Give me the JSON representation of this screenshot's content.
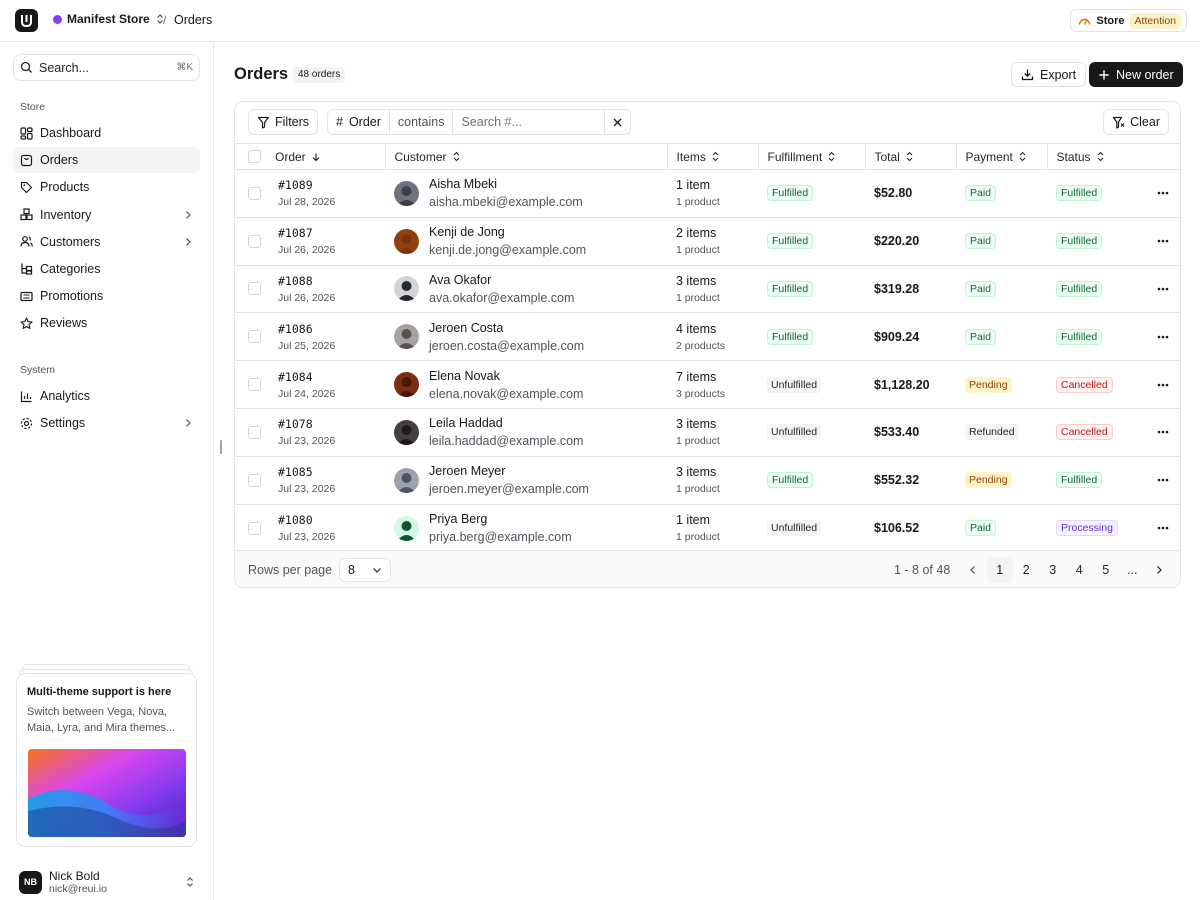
{
  "header": {
    "store_name": "Manifest Store",
    "breadcrumb_sep": "/",
    "breadcrumb_current": "Orders",
    "store_status_label": "Store",
    "store_status_badge": "Attention",
    "store_color": "#8b3cf0"
  },
  "sidebar": {
    "search_placeholder": "Search...",
    "search_shortcut": "⌘K",
    "section_store": "Store",
    "section_system": "System",
    "store_items": [
      {
        "label": "Dashboard",
        "icon": "dashboard-icon"
      },
      {
        "label": "Orders",
        "icon": "shopping-bag-icon",
        "active": true
      },
      {
        "label": "Products",
        "icon": "tag-icon"
      },
      {
        "label": "Inventory",
        "icon": "boxes-icon",
        "has_submenu": true
      },
      {
        "label": "Customers",
        "icon": "users-icon",
        "has_submenu": true
      },
      {
        "label": "Categories",
        "icon": "category-tree-icon"
      },
      {
        "label": "Promotions",
        "icon": "ticket-icon"
      },
      {
        "label": "Reviews",
        "icon": "star-icon"
      }
    ],
    "system_items": [
      {
        "label": "Analytics",
        "icon": "bar-chart-icon"
      },
      {
        "label": "Settings",
        "icon": "gear-icon",
        "has_submenu": true
      }
    ],
    "promo": {
      "title": "Multi-theme support is here",
      "text": "Switch between Vega, Nova, Maia, Lyra, and Mira themes..."
    },
    "user": {
      "initials": "NB",
      "name": "Nick Bold",
      "email": "nick@reui.io"
    }
  },
  "main": {
    "title": "Orders",
    "count_label": "48 orders",
    "export_label": "Export",
    "new_order_label": "New order",
    "filters_label": "Filters",
    "filter_field": "Order",
    "filter_operator": "contains",
    "filter_value_placeholder": "Search #...",
    "clear_label": "Clear"
  },
  "table": {
    "columns": [
      "Order",
      "Customer",
      "Items",
      "Fulfillment",
      "Total",
      "Payment",
      "Status"
    ],
    "rows": [
      {
        "id": "#1089",
        "date": "Jul 28, 2026",
        "name": "Aisha Mbeki",
        "email": "aisha.mbeki@example.com",
        "items": "1 item",
        "products": "1 product",
        "fulfillment": "Fulfilled",
        "total": "$52.80",
        "payment": "Paid",
        "status": "Fulfilled"
      },
      {
        "id": "#1087",
        "date": "Jul 26, 2026",
        "name": "Kenji de Jong",
        "email": "kenji.de.jong@example.com",
        "items": "2 items",
        "products": "1 product",
        "fulfillment": "Fulfilled",
        "total": "$220.20",
        "payment": "Paid",
        "status": "Fulfilled"
      },
      {
        "id": "#1088",
        "date": "Jul 26, 2026",
        "name": "Ava Okafor",
        "email": "ava.okafor@example.com",
        "items": "3 items",
        "products": "1 product",
        "fulfillment": "Fulfilled",
        "total": "$319.28",
        "payment": "Paid",
        "status": "Fulfilled"
      },
      {
        "id": "#1086",
        "date": "Jul 25, 2026",
        "name": "Jeroen Costa",
        "email": "jeroen.costa@example.com",
        "items": "4 items",
        "products": "2 products",
        "fulfillment": "Fulfilled",
        "total": "$909.24",
        "payment": "Paid",
        "status": "Fulfilled"
      },
      {
        "id": "#1084",
        "date": "Jul 24, 2026",
        "name": "Elena Novak",
        "email": "elena.novak@example.com",
        "items": "7 items",
        "products": "3 products",
        "fulfillment": "Unfulfilled",
        "total": "$1,128.20",
        "payment": "Pending",
        "status": "Cancelled"
      },
      {
        "id": "#1078",
        "date": "Jul 23, 2026",
        "name": "Leila Haddad",
        "email": "leila.haddad@example.com",
        "items": "3 items",
        "products": "1 product",
        "fulfillment": "Unfulfilled",
        "total": "$533.40",
        "payment": "Refunded",
        "status": "Cancelled"
      },
      {
        "id": "#1085",
        "date": "Jul 23, 2026",
        "name": "Jeroen Meyer",
        "email": "jeroen.meyer@example.com",
        "items": "3 items",
        "products": "1 product",
        "fulfillment": "Fulfilled",
        "total": "$552.32",
        "payment": "Pending",
        "status": "Fulfilled"
      },
      {
        "id": "#1080",
        "date": "Jul 23, 2026",
        "name": "Priya Berg",
        "email": "priya.berg@example.com",
        "items": "1 item",
        "products": "1 product",
        "fulfillment": "Unfulfilled",
        "total": "$106.52",
        "payment": "Paid",
        "status": "Processing"
      }
    ]
  },
  "footer": {
    "rows_per_page_label": "Rows per page",
    "rows_per_page_value": "8",
    "range_label": "1 - 8 of 48",
    "pages": [
      "1",
      "2",
      "3",
      "4",
      "5",
      "..."
    ],
    "current_page": "1"
  }
}
